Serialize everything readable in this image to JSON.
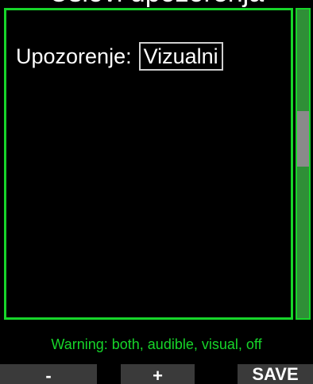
{
  "header": {
    "title": "Uslovi upozorenja"
  },
  "setting": {
    "label": "Upozorenje:",
    "value": "Vizualni"
  },
  "scrollbar": {
    "position_fraction": 0.33,
    "thumb_fraction": 0.18
  },
  "help": {
    "text": "Warning: both, audible, visual, off"
  },
  "softkeys": {
    "left": "-",
    "middle": "+",
    "right": "SAVE"
  },
  "colors": {
    "accent": "#17d52a",
    "scroll_track": "#2f8f37",
    "scroll_thumb": "#8a8a8a",
    "softkey_bg": "#3a3a3a"
  }
}
